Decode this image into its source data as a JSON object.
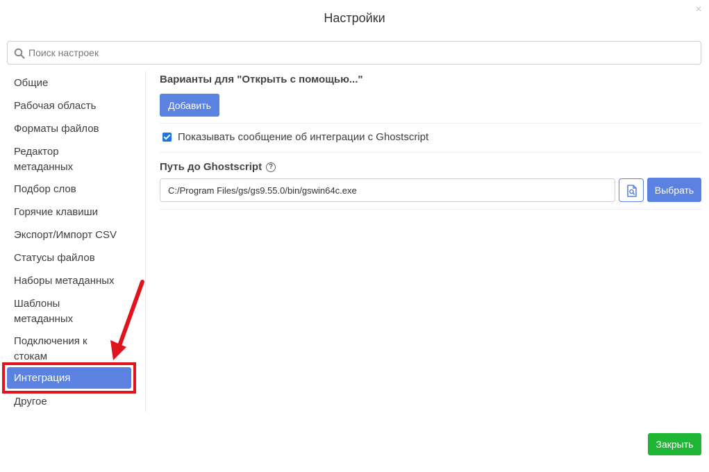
{
  "dialog": {
    "title": "Настройки",
    "close_glyph": "×"
  },
  "search": {
    "placeholder": "Поиск настроек",
    "value": ""
  },
  "sidebar": {
    "items": [
      {
        "label": "Общие"
      },
      {
        "label": "Рабочая область"
      },
      {
        "label": "Форматы файлов"
      },
      {
        "label": "Редактор метаданных"
      },
      {
        "label": "Подбор слов"
      },
      {
        "label": "Горячие клавиши"
      },
      {
        "label": "Экспорт/Импорт CSV"
      },
      {
        "label": "Статусы файлов"
      },
      {
        "label": "Наборы метаданных"
      },
      {
        "label": "Шаблоны метаданных"
      },
      {
        "label": "Подключения к стокам"
      },
      {
        "label": "Интеграция",
        "active": true
      },
      {
        "label": "Другое"
      }
    ]
  },
  "integration": {
    "open_with_title": "Варианты для \"Открыть с помощью...\"",
    "add_button": "Добавить",
    "show_message_checkbox": {
      "checked": true,
      "label": "Показывать сообщение об интеграции с Ghostscript"
    },
    "ghostscript_path": {
      "title": "Путь до Ghostscript",
      "help_glyph": "?",
      "value": "C:/Program Files/gs/gs9.55.0/bin/gswin64c.exe",
      "browse_button": "Выбрать"
    }
  },
  "footer": {
    "close_button": "Закрыть"
  },
  "colors": {
    "accent": "#5b82e0",
    "success": "#1fb636",
    "annotation": "#e0141c"
  }
}
